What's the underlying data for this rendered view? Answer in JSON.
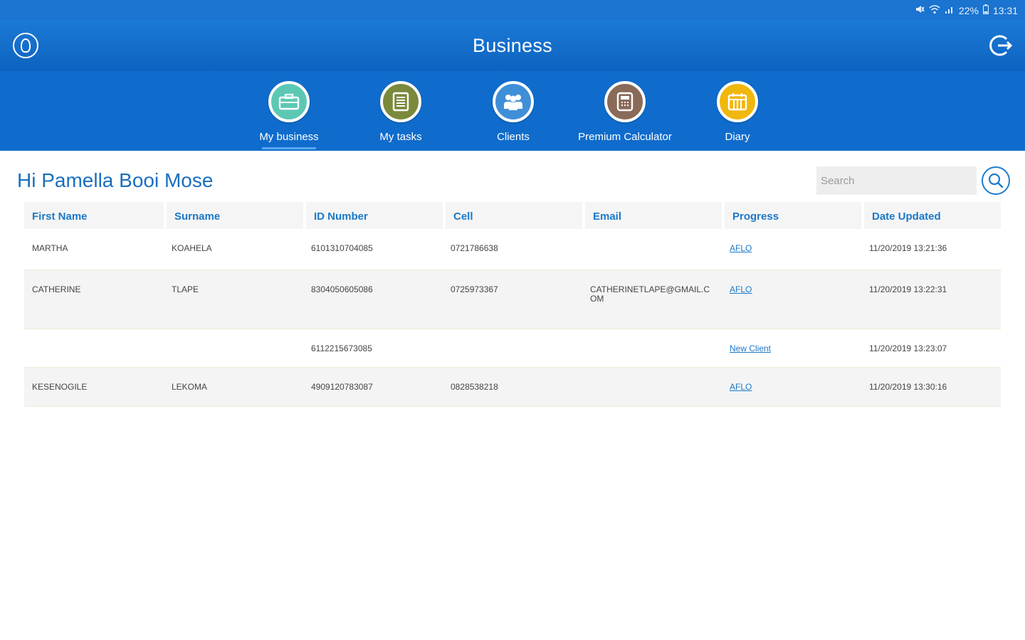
{
  "status": {
    "battery": "22%",
    "time": "13:31"
  },
  "app": {
    "title": "Business"
  },
  "nav": [
    {
      "label": "My business",
      "color": "#5cc8b4",
      "icon": "briefcase-icon",
      "active": true
    },
    {
      "label": "My tasks",
      "color": "#7a8a3c",
      "icon": "list-icon",
      "active": false
    },
    {
      "label": "Clients",
      "color": "#3f8fd8",
      "icon": "people-icon",
      "active": false
    },
    {
      "label": "Premium Calculator",
      "color": "#8a6a58",
      "icon": "calculator-icon",
      "active": false
    },
    {
      "label": "Diary",
      "color": "#f0b70d",
      "icon": "calendar-icon",
      "active": false
    }
  ],
  "greeting": "Hi Pamella  Booi Mose",
  "search": {
    "placeholder": "Search"
  },
  "table": {
    "headers": [
      "First Name",
      "Surname",
      "ID Number",
      "Cell",
      "Email",
      "Progress",
      "Date Updated"
    ],
    "rows": [
      {
        "first_name": "MARTHA",
        "surname": "KOAHELA",
        "id_number": "6101310704085",
        "cell": "0721786638",
        "email": "",
        "progress": "AFLO",
        "date_updated": "11/20/2019 13:21:36"
      },
      {
        "first_name": "CATHERINE",
        "surname": "TLAPE",
        "id_number": "8304050605086",
        "cell": "0725973367",
        "email": "CATHERINETLAPE@GMAIL.COM",
        "progress": "AFLO",
        "date_updated": "11/20/2019 13:22:31"
      },
      {
        "first_name": "",
        "surname": "",
        "id_number": "6112215673085",
        "cell": "",
        "email": "",
        "progress": "New Client",
        "date_updated": "11/20/2019 13:23:07"
      },
      {
        "first_name": "KESENOGILE",
        "surname": "LEKOMA",
        "id_number": "4909120783087",
        "cell": "0828538218",
        "email": "",
        "progress": "AFLO",
        "date_updated": "11/20/2019 13:30:16"
      }
    ]
  }
}
